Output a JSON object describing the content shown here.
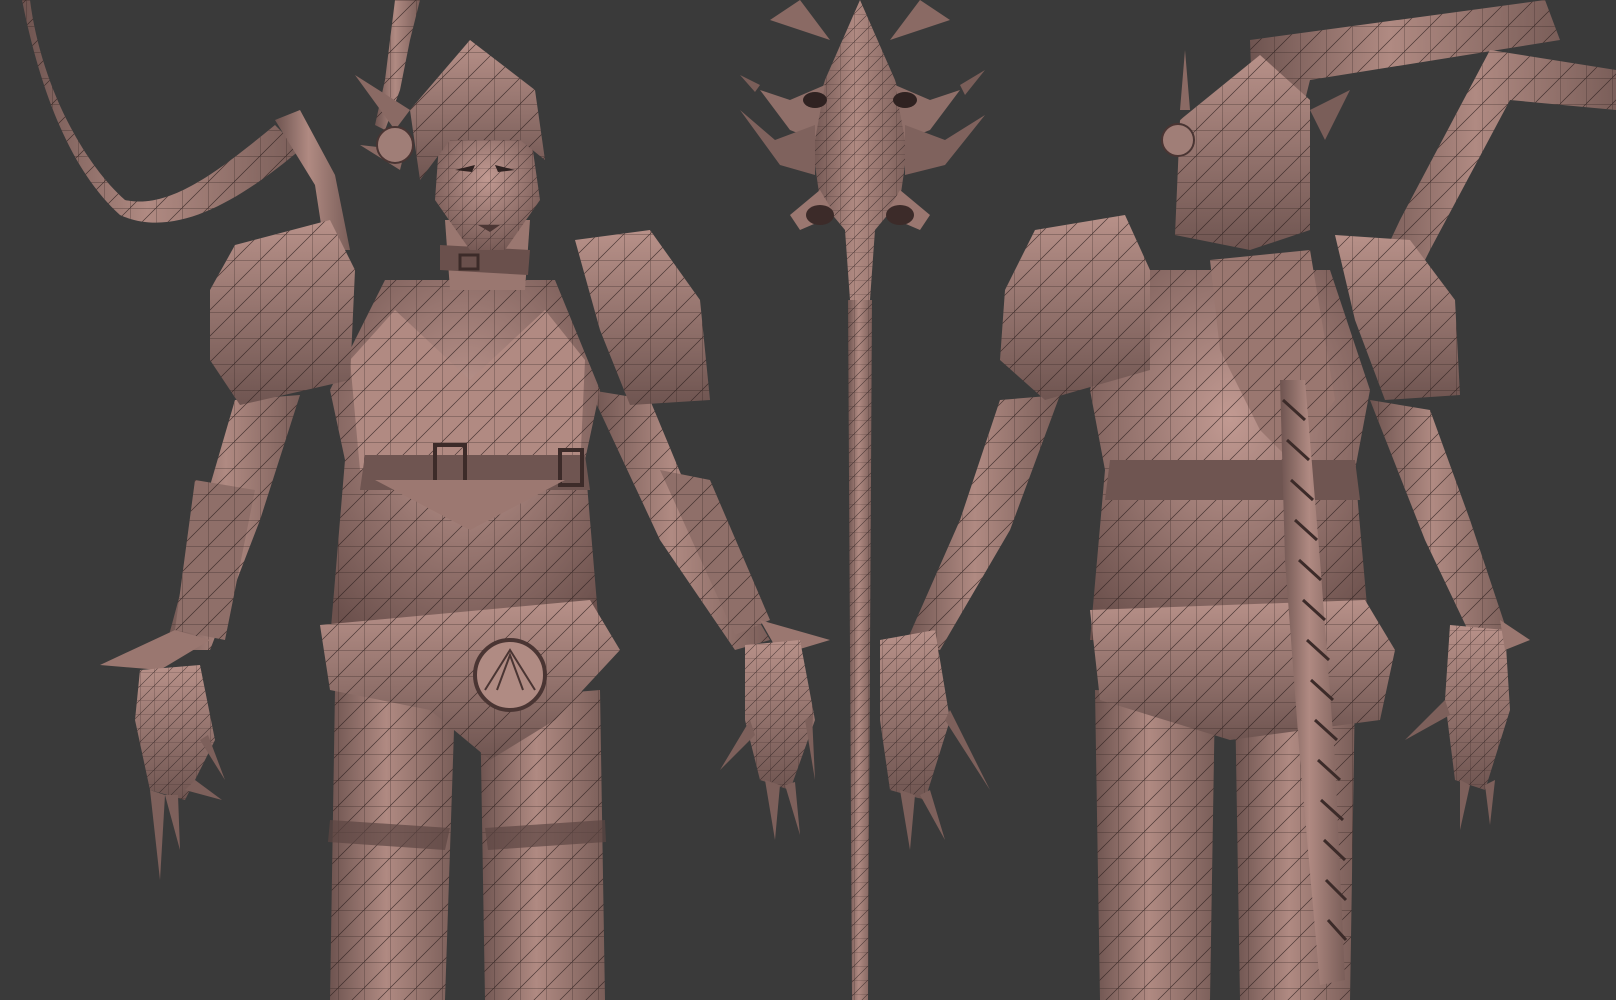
{
  "scene": {
    "background": "#3a3a3a",
    "clay": "#a27e77",
    "clay_dark": "#6e5450",
    "clay_light": "#c9a39b",
    "wire": "#2a1d1c",
    "rim": "#5fa7b5",
    "views": [
      "front-view",
      "staff-view",
      "back-view"
    ]
  }
}
